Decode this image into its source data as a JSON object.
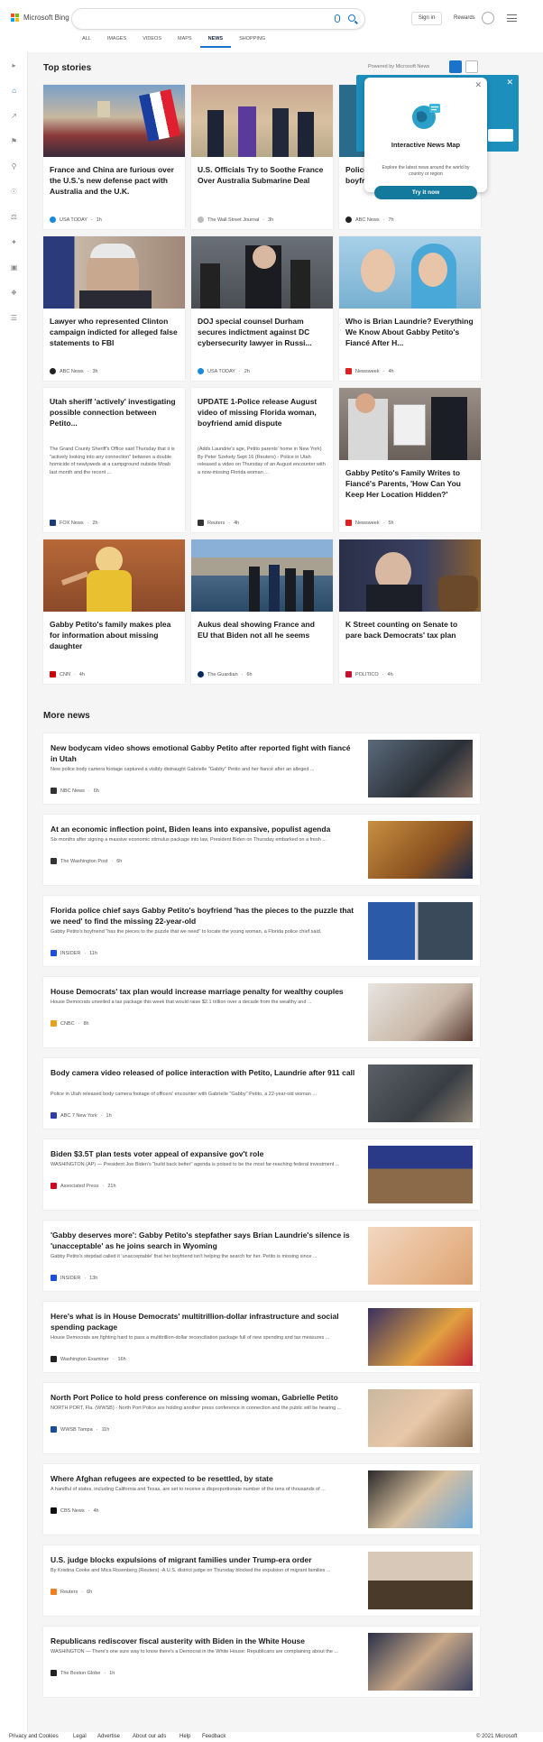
{
  "header": {
    "brand": "Microsoft Bing",
    "sign_in": "Sign in",
    "rewards": "Rewards"
  },
  "tabs": [
    "ALL",
    "IMAGES",
    "VIDEOS",
    "MAPS",
    "NEWS",
    "SHOPPING"
  ],
  "top_stories": {
    "title": "Top stories",
    "powered": "Powered by Microsoft News"
  },
  "popup": {
    "title": "Interactive News Map",
    "desc": "Explore the latest news around the world by country or region",
    "button": "Try it now"
  },
  "cards": [
    {
      "title": "France and China are furious over the U.S.'s new defense pact with Australia and the U.K.",
      "source": "USA TODAY",
      "time": "1h",
      "color": "#1a8ad8"
    },
    {
      "title": "U.S. Officials Try to Soothe France Over Australia Submarine Deal",
      "source": "The Wall Street Journal",
      "time": "3h",
      "color": "#999"
    },
    {
      "title": "Police boyfriend",
      "source": "ABC News",
      "time": "7h",
      "color": "#222"
    },
    {
      "title": "Lawyer who represented Clinton campaign indicted for alleged false statements to FBI",
      "source": "ABC News",
      "time": "3h",
      "color": "#222"
    },
    {
      "title": "DOJ special counsel Durham secures indictment against DC cybersecurity lawyer in Russi...",
      "source": "USA TODAY",
      "time": "2h",
      "color": "#1a8ad8"
    },
    {
      "title": "Who is Brian Laundrie? Everything We Know About Gabby Petito's Fiancé After H...",
      "source": "Newsweek",
      "time": "4h",
      "color": "#e02020"
    },
    {
      "title": "Utah sheriff 'actively' investigating possible connection between Petito...",
      "abstract": "The Grand County Sheriff's Office said Thursday that it is \"actively looking into any connection\" between a double homicide of newlyweds at a campground outside Moab last month and the recent ...",
      "source": "FOX News",
      "time": "2h",
      "color": "#1a3a7a"
    },
    {
      "title": "UPDATE 1-Police release August video of missing Florida woman, boyfriend amid dispute",
      "abstract": "(Adds Laundrie's age, Petito parents' home in New York) By Peter Szekely Sept 16 (Reuters) - Police in Utah released a video on Thursday of an August encounter with a now-missing Florida woman ...",
      "source": "Reuters",
      "time": "4h",
      "color": "#333"
    },
    {
      "title": "Gabby Petito's Family Writes to Fiancé's Parents, 'How Can You Keep Her Location Hidden?'",
      "source": "Newsweek",
      "time": "5h",
      "color": "#e02020"
    },
    {
      "title": "Gabby Petito's family makes plea for information about missing daughter",
      "source": "CNN",
      "time": "4h",
      "color": "#cc0000"
    },
    {
      "title": "Aukus deal showing France and EU that Biden not all he seems",
      "source": "The Guardian",
      "time": "6h",
      "color": "#052962"
    },
    {
      "title": "K Street counting on Senate to pare back Democrats' tax plan",
      "source": "POLITICO",
      "time": "4h",
      "color": "#c8102e"
    }
  ],
  "more_news": {
    "title": "More news",
    "items": [
      {
        "title": "New bodycam video shows emotional Gabby Petito after reported fight with fiancé in Utah",
        "abstract": "New police body camera footage captured a visibly distraught Gabrielle \"Gabby\" Petito and her fiancé after an alleged ...",
        "source": "NBC News",
        "time": "6h",
        "color": "#333"
      },
      {
        "title": "At an economic inflection point, Biden leans into expansive, populist agenda",
        "abstract": "Six months after signing a massive economic stimulus package into law, President Biden on Thursday embarked on a fresh ...",
        "source": "The Washington Post",
        "time": "6h",
        "color": "#333"
      },
      {
        "title": "Florida police chief says Gabby Petito's boyfriend 'has the pieces to the puzzle that we need' to find the missing 22-year-old",
        "abstract": "Gabby Petito's boyfriend \"has the pieces to the puzzle that we need\" to locate the young woman, a Florida police chief said.",
        "source": "INSIDER",
        "time": "11h",
        "color": "#1a4fd8"
      },
      {
        "title": "House Democrats' tax plan would increase marriage penalty for wealthy couples",
        "abstract": "House Democrats unveiled a tax package this week that would raise $2.1 trillion over a decade from the wealthy and ...",
        "source": "CNBC",
        "time": "8h",
        "color": "#e8a020"
      },
      {
        "title": "Body camera video released of police interaction with Petito, Laundrie after 911 call",
        "abstract": "Police in Utah released body camera footage of officers' encounter with Gabrielle \"Gabby\" Petito, a 22-year-old woman ...",
        "source": "ABC 7 New York",
        "time": "1h",
        "color": "#2c3ea8"
      },
      {
        "title": "Biden $3.5T plan tests voter appeal of expansive gov't role",
        "abstract": "WASHINGTON (AP) — President Joe Biden's \"build back better\" agenda is poised to be the most far-reaching federal investment ...",
        "source": "Associated Press",
        "time": "21h",
        "color": "#d0021b"
      },
      {
        "title": "'Gabby deserves more': Gabby Petito's stepfather says Brian Laundrie's silence is 'unacceptable' as he joins search in Wyoming",
        "abstract": "Gabby Petito's stepdad called it 'unacceptable' that her boyfriend isn't helping the search for her. Petito is missing since ...",
        "source": "INSIDER",
        "time": "13h",
        "color": "#1a4fd8"
      },
      {
        "title": "Here's what is in House Democrats' multitrillion-dollar infrastructure and social spending package",
        "abstract": "House Democrats are fighting hard to pass a multitrillion-dollar reconciliation package full of new spending and tax measures ...",
        "source": "Washington Examiner",
        "time": "16h",
        "color": "#222"
      },
      {
        "title": "North Port Police to hold press conference on missing woman, Gabrielle Petito",
        "abstract": "NORTH PORT, Fla. (WWSB) - North Port Police are holding another press conference in connection and the public will be hearing ...",
        "source": "WWSB Tampa",
        "time": "11h",
        "color": "#1a4a9a"
      },
      {
        "title": "Where Afghan refugees are expected to be resettled, by state",
        "abstract": "A handful of states, including California and Texas, are set to receive a disproportionate number of the tens of thousands of ...",
        "source": "CBS News",
        "time": "4h",
        "color": "#111"
      },
      {
        "title": "U.S. judge blocks expulsions of migrant families under Trump-era order",
        "abstract": "By Kristina Cooke and Mica Rosenberg (Reuters) -A U.S. district judge on Thursday blocked the expulsion of migrant families ...",
        "source": "Reuters",
        "time": "6h",
        "color": "#f08020"
      },
      {
        "title": "Republicans rediscover fiscal austerity with Biden in the White House",
        "abstract": "WASHINGTON — There's one sure way to know there's a Democrat in the White House: Republicans are complaining about the ...",
        "source": "The Boston Globe",
        "time": "1h",
        "color": "#222"
      }
    ]
  },
  "footer": {
    "privacy": "Privacy and Cookies",
    "legal": "Legal",
    "advertise": "Advertise",
    "about_ads": "About our ads",
    "help": "Help",
    "feedback": "Feedback",
    "copyright": "© 2021 Microsoft"
  }
}
